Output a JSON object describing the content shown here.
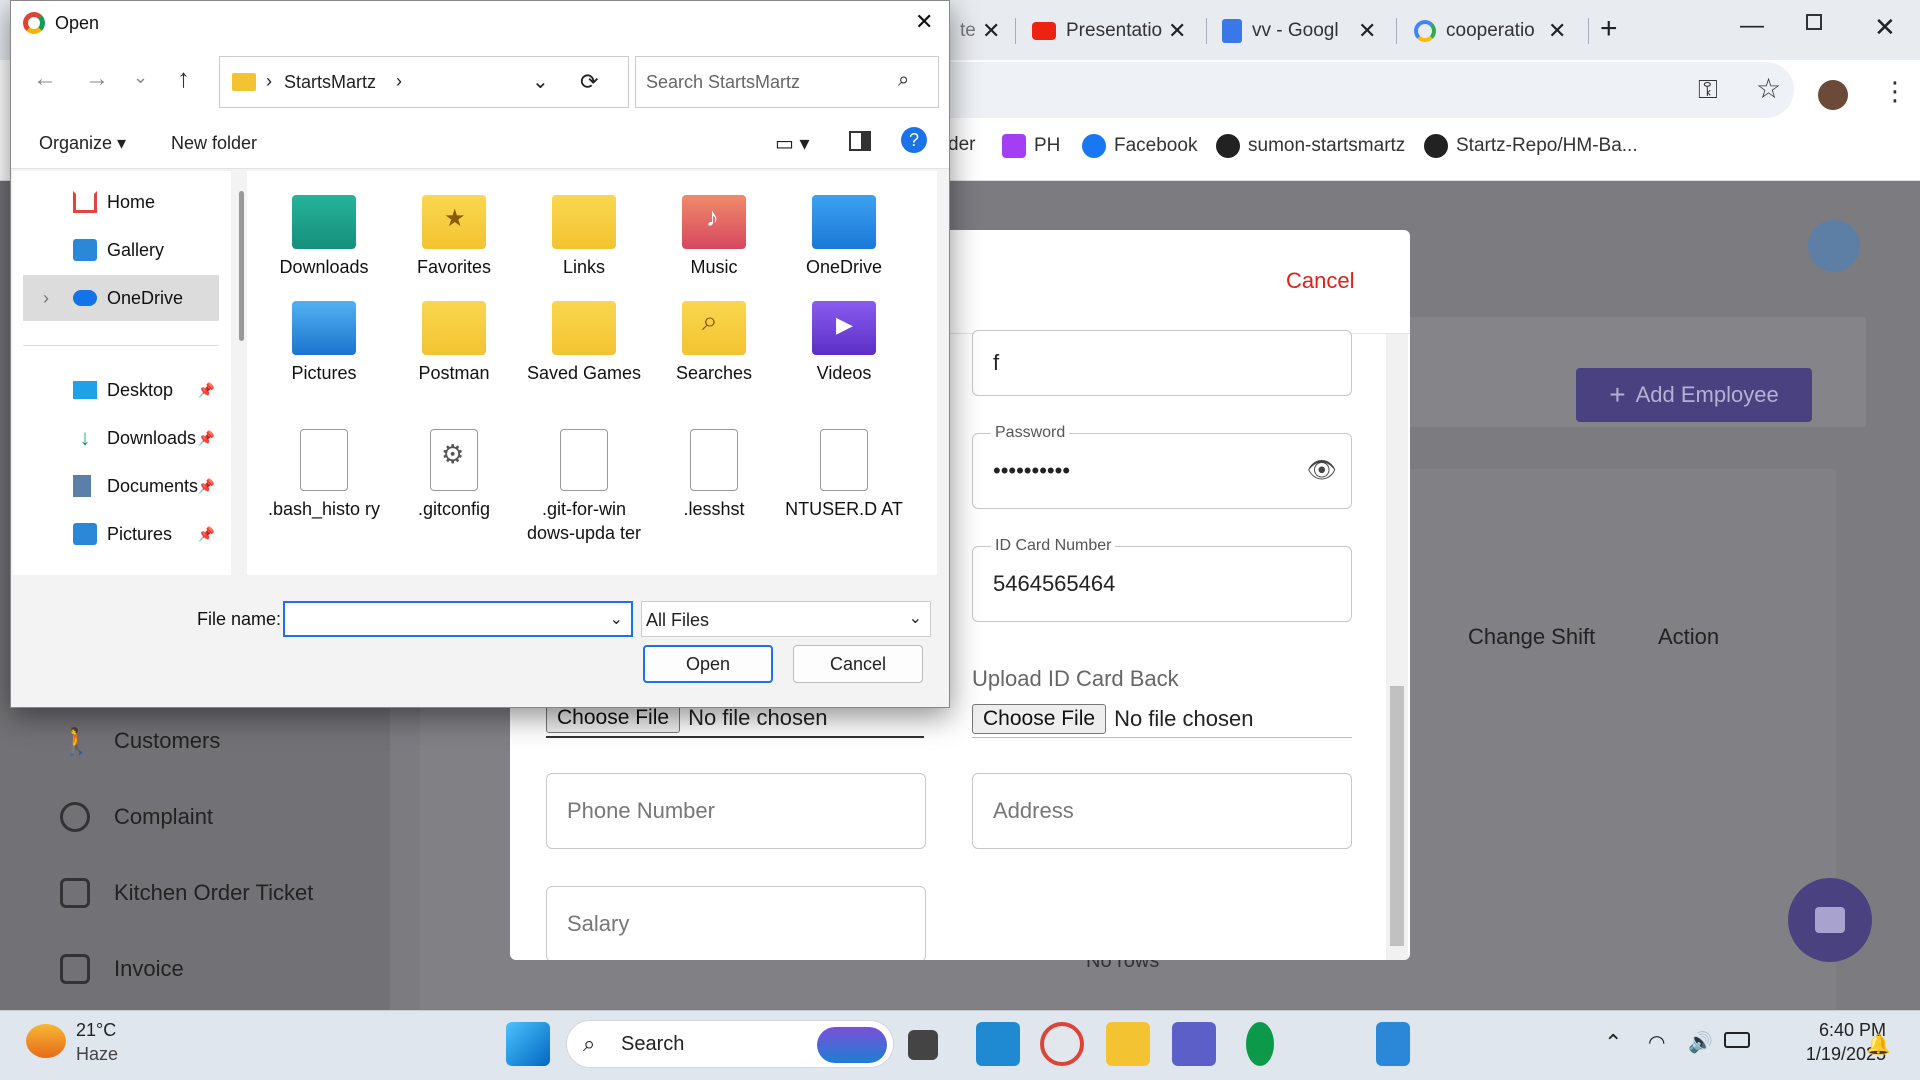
{
  "browser": {
    "tabs": [
      {
        "label": "Presentatio"
      },
      {
        "label": "vv - Googl"
      },
      {
        "label": "cooperatio"
      }
    ],
    "bookmarks": [
      {
        "label": "der"
      },
      {
        "label": "PH"
      },
      {
        "label": "Facebook"
      },
      {
        "label": "sumon-startsmartz"
      },
      {
        "label": "Startz-Repo/HM-Ba..."
      }
    ]
  },
  "app": {
    "sidebar": [
      {
        "label": "Customers"
      },
      {
        "label": "Complaint"
      },
      {
        "label": "Kitchen Order Ticket"
      },
      {
        "label": "Invoice"
      }
    ],
    "add_employee": "Add Employee",
    "columns": {
      "change_shift": "Change Shift",
      "action": "Action"
    },
    "no_rows": "No rows"
  },
  "modal": {
    "cancel": "Cancel",
    "name_value": "f",
    "password_label": "Password",
    "password_value": "••••••••••",
    "id_label": "ID Card Number",
    "id_value": "5464565464",
    "upload_back_label": "Upload ID Card Back",
    "choose_file": "Choose File",
    "no_file": "No file chosen",
    "phone_placeholder": "Phone Number",
    "address_placeholder": "Address",
    "salary_placeholder": "Salary"
  },
  "dialog": {
    "title": "Open",
    "breadcrumb": "StartsMartz",
    "search_placeholder": "Search StartsMartz",
    "organize": "Organize",
    "new_folder": "New folder",
    "nav_items": [
      {
        "label": "Home",
        "pinned": false
      },
      {
        "label": "Gallery",
        "pinned": false
      },
      {
        "label": "OneDrive",
        "pinned": false
      },
      {
        "label": "Desktop",
        "pinned": true
      },
      {
        "label": "Downloads",
        "pinned": true
      },
      {
        "label": "Documents",
        "pinned": true
      },
      {
        "label": "Pictures",
        "pinned": true
      }
    ],
    "items_row1": [
      "Downloads",
      "Favorites",
      "Links",
      "Music",
      "OneDrive"
    ],
    "items_row2": [
      "Pictures",
      "Postman",
      "Saved Games",
      "Searches",
      "Videos"
    ],
    "items_row3": [
      ".bash_histo ry",
      ".gitconfig",
      ".git-for-win dows-upda ter",
      ".lesshst",
      "NTUSER.D AT"
    ],
    "file_name_label": "File name:",
    "file_type": "All Files",
    "open": "Open",
    "cancel": "Cancel"
  },
  "taskbar": {
    "weather_temp": "21°C",
    "weather_desc": "Haze",
    "search": "Search",
    "time": "6:40 PM",
    "date": "1/19/2025"
  }
}
